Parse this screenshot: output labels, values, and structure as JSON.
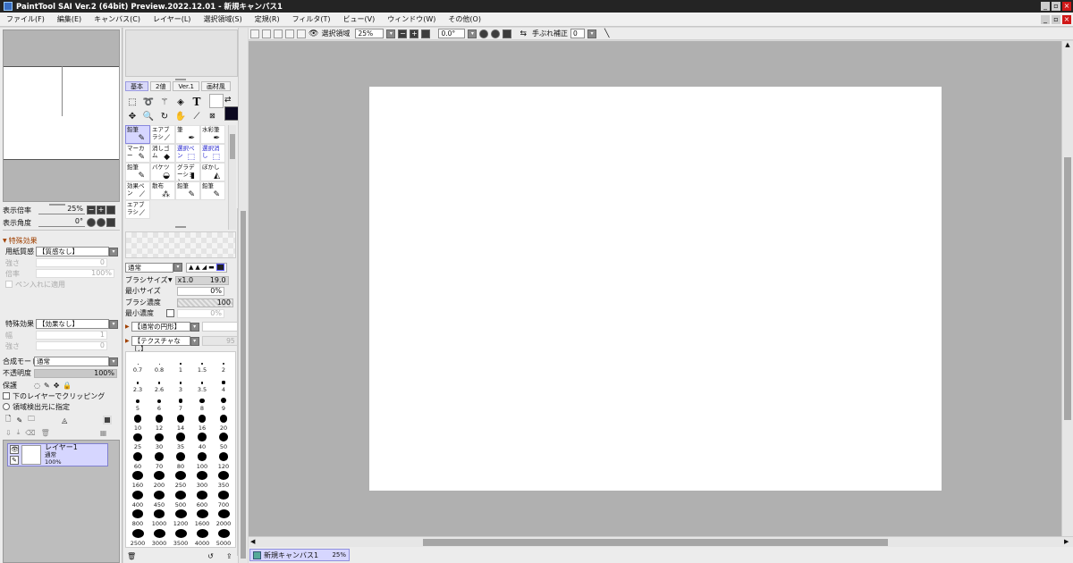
{
  "title_bar": {
    "title": "PaintTool SAI Ver.2 (64bit) Preview.2022.12.01 - 新規キャンバス1"
  },
  "menus": [
    "ファイル(F)",
    "編集(E)",
    "キャンバス(C)",
    "レイヤー(L)",
    "選択領域(S)",
    "定規(R)",
    "フィルタ(T)",
    "ビュー(V)",
    "ウィンドウ(W)",
    "その他(O)"
  ],
  "window_buttons": {
    "minimize": "_",
    "restore": "▫",
    "close": "×"
  },
  "navigator": {
    "zoom_label": "表示倍率",
    "zoom_value": "25%",
    "angle_label": "表示角度",
    "angle_value": "0°"
  },
  "effects": {
    "header": "特殊効果",
    "paper_label": "用紙質感",
    "paper_value": "【質感なし】",
    "scale_label": "倍率",
    "scale_value": "100%",
    "strength_label": "強さ",
    "strength_value": "0",
    "pen_apply": "ペン入れに適用",
    "effect_label": "特殊効果",
    "effect_value": "【効果なし】",
    "width_label": "幅",
    "width_value": "1",
    "strength2_label": "強さ",
    "strength2_value": "0"
  },
  "layer_props": {
    "blend_label": "合成モード",
    "blend_value": "通常",
    "opacity_label": "不透明度",
    "opacity_value": "100%",
    "protect_label": "保護",
    "clip_label": "下のレイヤーでクリッピング",
    "source_label": "領域検出元に指定"
  },
  "layers": [
    {
      "name": "レイヤー1",
      "mode": "通常",
      "opacity": "100%"
    }
  ],
  "tool_tabs": [
    "基本",
    "2値",
    "Ver.1",
    "画材風"
  ],
  "tool_text_glyph": "T",
  "brushes": [
    {
      "label": "鉛筆",
      "icon": "✎",
      "selected": true
    },
    {
      "label": "エアブラシ",
      "icon": "⟋"
    },
    {
      "label": "筆",
      "icon": "✒"
    },
    {
      "label": "水彩筆",
      "icon": "✒"
    },
    {
      "label": "マーカー",
      "icon": "✎"
    },
    {
      "label": "消しゴム",
      "icon": "◆"
    },
    {
      "label": "選択ペン",
      "icon": "⬚",
      "blue": true
    },
    {
      "label": "選択消し",
      "icon": "⬚",
      "blue": true
    },
    {
      "label": "鉛筆",
      "icon": "✎"
    },
    {
      "label": "バケツ",
      "icon": "◒"
    },
    {
      "label": "グラデーション",
      "icon": "▮"
    },
    {
      "label": "ぼかし",
      "icon": "◭"
    },
    {
      "label": "効果ペン",
      "icon": "⟋"
    },
    {
      "label": "散布",
      "icon": "⁂"
    },
    {
      "label": "鉛筆",
      "icon": "✎"
    },
    {
      "label": "鉛筆",
      "icon": "✎"
    },
    {
      "label": "エアブラシ",
      "icon": "⟋"
    }
  ],
  "brush_settings": {
    "mode_value": "通常",
    "size_label": "ブラシサイズ",
    "size_mult": "x1.0",
    "size_value": "19.0",
    "min_size_label": "最小サイズ",
    "min_size_value": "0%",
    "density_label": "ブラシ濃度",
    "density_value": "100",
    "min_density_label": "最小濃度",
    "min_density_value": "0%",
    "shape_value": "【通常の円形】",
    "texture_value": "【テクスチャなし】",
    "texture_amount": "95"
  },
  "brush_sizes": [
    "0.7",
    "0.8",
    "1",
    "1.5",
    "2",
    "2.3",
    "2.6",
    "3",
    "3.5",
    "4",
    "5",
    "6",
    "7",
    "8",
    "9",
    "10",
    "12",
    "14",
    "16",
    "20",
    "25",
    "30",
    "35",
    "40",
    "50",
    "60",
    "70",
    "80",
    "100",
    "120",
    "160",
    "200",
    "250",
    "300",
    "350",
    "400",
    "450",
    "500",
    "600",
    "700",
    "800",
    "1000",
    "1200",
    "1600",
    "2000",
    "2500",
    "3000",
    "3500",
    "4000",
    "5000"
  ],
  "toolbar": {
    "selection_label": "選択領域",
    "zoom_value": "25%",
    "angle_value": "0.0°",
    "stabilizer_label": "手ぶれ補正",
    "stabilizer_value": "0"
  },
  "canvas_tab": {
    "name": "新規キャンバス1",
    "zoom": "25%"
  },
  "colors": {
    "foreground": "#0b0820",
    "background": "#ffffff",
    "workspace": "#b0b0b0",
    "selection": "#d6d6ff"
  }
}
